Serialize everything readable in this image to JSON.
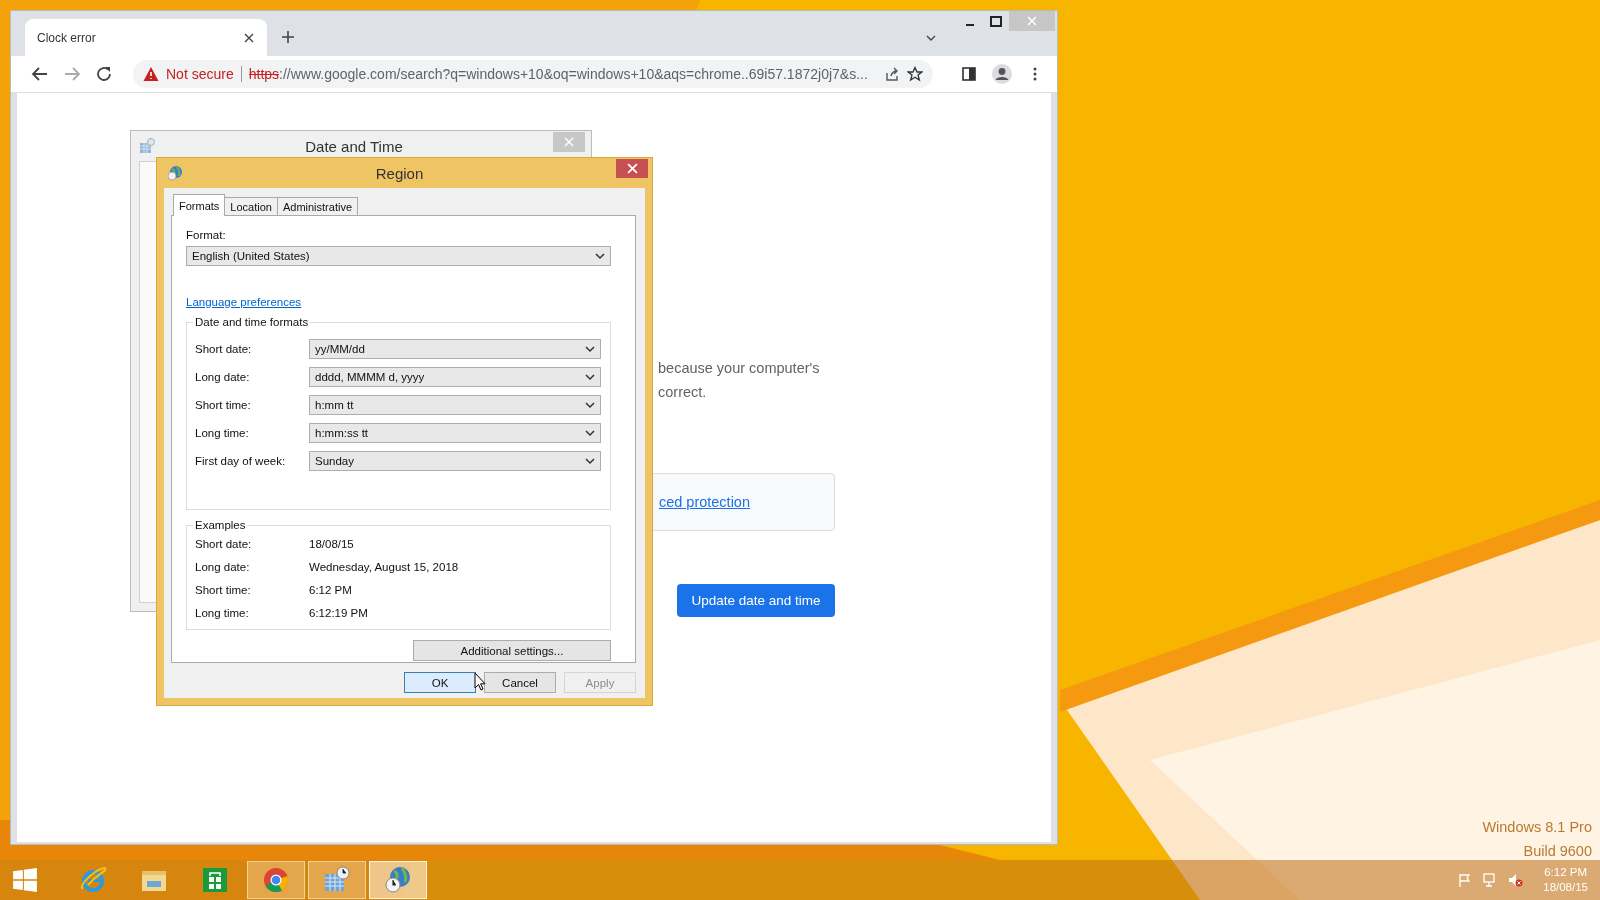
{
  "browser": {
    "tab_title": "Clock error",
    "security": "Not secure",
    "url_scheme": "https",
    "url_rest": "://www.google.com/search?q=windows+10&oq=windows+10&aqs=chrome..69i57.1872j0j7&s..."
  },
  "page": {
    "paragraph_lines": [
      "because your computer's",
      "correct."
    ],
    "link": "ced protection",
    "button": "Update date and time"
  },
  "back_window": {
    "title": "Date and Time"
  },
  "dialog": {
    "title": "Region",
    "tabs": [
      {
        "label": "Formats",
        "selected": true
      },
      {
        "label": "Location",
        "selected": false
      },
      {
        "label": "Administrative",
        "selected": false
      }
    ],
    "format_label": "Format:",
    "format_value": "English (United States)",
    "language_link": "Language preferences",
    "formats_group": "Date and time formats",
    "formats": [
      {
        "label": "Short date:",
        "value": "yy/MM/dd"
      },
      {
        "label": "Long date:",
        "value": "dddd, MMMM d, yyyy"
      },
      {
        "label": "Short time:",
        "value": "h:mm tt"
      },
      {
        "label": "Long time:",
        "value": "h:mm:ss tt"
      },
      {
        "label": "First day of week:",
        "value": "Sunday"
      }
    ],
    "examples_group": "Examples",
    "examples": [
      {
        "label": "Short date:",
        "value": "18/08/15"
      },
      {
        "label": "Long date:",
        "value": "Wednesday, August 15, 2018"
      },
      {
        "label": "Short time:",
        "value": "6:12 PM"
      },
      {
        "label": "Long time:",
        "value": "6:12:19 PM"
      }
    ],
    "additional_button": "Additional settings...",
    "buttons": [
      {
        "label": "OK",
        "kind": "default",
        "disabled": false
      },
      {
        "label": "Cancel",
        "kind": "normal",
        "disabled": false
      },
      {
        "label": "Apply",
        "kind": "normal",
        "disabled": true
      }
    ]
  },
  "desktop": {
    "edition": "Windows 8.1 Pro",
    "build": "Build 9600"
  },
  "taskbar": {
    "apps": [
      {
        "kind": "ie",
        "running": false,
        "selected": false
      },
      {
        "kind": "explorer",
        "running": false,
        "selected": false
      },
      {
        "kind": "store",
        "running": false,
        "selected": false
      },
      {
        "kind": "chrome",
        "running": true,
        "selected": false
      },
      {
        "kind": "datetime",
        "running": true,
        "selected": false
      },
      {
        "kind": "region",
        "running": true,
        "selected": true
      }
    ],
    "time": "6:12 PM",
    "date": "18/08/15"
  }
}
